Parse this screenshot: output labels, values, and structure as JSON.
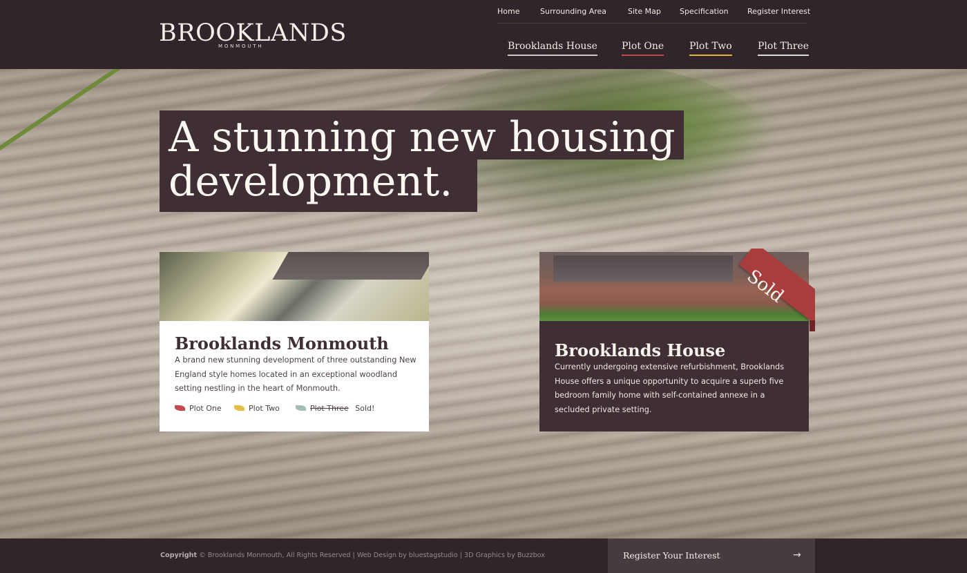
{
  "brand": {
    "name": "BROOKLANDS",
    "sub": "MONMOUTH"
  },
  "top_nav": [
    "Home",
    "Surrounding  Area",
    "Site Map",
    "Specification",
    "Register Interest"
  ],
  "main_nav": [
    "Brooklands House",
    "Plot One",
    "Plot Two",
    "Plot Three"
  ],
  "hero": {
    "line1": "A stunning new housing",
    "line2": "development."
  },
  "card_left": {
    "title": "Brooklands Monmouth",
    "desc": "A brand new stunning development of three outstanding New England style homes located in an exceptional woodland setting nestling in the heart of Monmouth.",
    "plots": [
      {
        "label": "Plot One",
        "icon": "red-leaf-icon",
        "color": "#c84a4f"
      },
      {
        "label": "Plot Two",
        "icon": "yellow-leaf-icon",
        "color": "#e5bf43"
      },
      {
        "label": "Plot Three",
        "icon": "green-leaf-icon",
        "color": "#a7bdb4",
        "status": "Sold!"
      }
    ]
  },
  "card_right": {
    "ribbon": "Sold",
    "title": "Brooklands House",
    "desc": "Currently undergoing extensive refurbishment, Brooklands House offers a unique opportunity to acquire a superb five bedroom family home with self-contained annexe in a secluded private setting."
  },
  "footer": {
    "copyright_label": "Copyright",
    "copyright_text": "© Brooklands Monmouth, All Rights Reserved | Web Design by bluestagstudio | 3D Graphics by Buzzbox",
    "register_label": "Register Your Interest",
    "register_icon": "arrow-right-icon"
  },
  "colors": {
    "header_bg": "#30252a",
    "panel_bg": "#3f2f35",
    "plot_one": "#c2494e",
    "plot_two": "#e0b63a",
    "sold_ribbon": "#a73d3d"
  }
}
